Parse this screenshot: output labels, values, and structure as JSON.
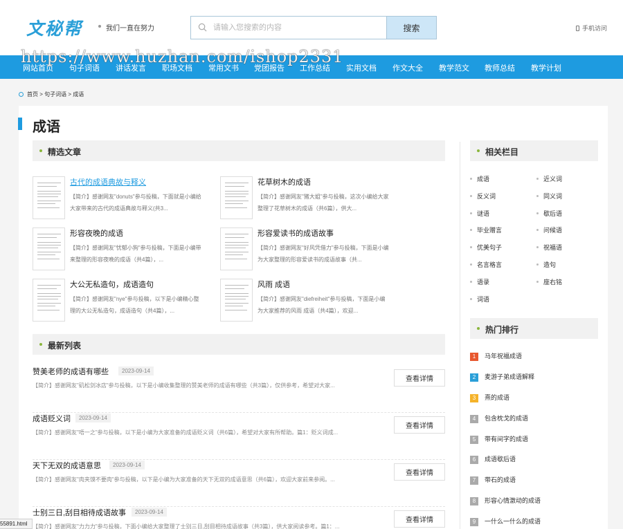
{
  "header": {
    "logo_text": "文秘帮",
    "slogan": "我们一直在努力",
    "search_placeholder": "请输入您搜索的内容",
    "search_button": "搜索",
    "mobile_link": "手机访问"
  },
  "nav": {
    "items": [
      "网站首页",
      "句子词语",
      "讲话发言",
      "职场文档",
      "常用文书",
      "党团报告",
      "工作总结",
      "实用文档",
      "作文大全",
      "教学范文",
      "教师总结",
      "教学计划"
    ],
    "watermark": "https://www.huzhan.com/ishop2331"
  },
  "breadcrumb": {
    "home": "首页",
    "sep": ">",
    "level1": "句子词语",
    "current": "成语"
  },
  "page_title": "成语",
  "featured": {
    "heading": "精选文章",
    "items": [
      {
        "title": "古代的成语典故与释义",
        "desc": "【简介】感谢网友\"donuts\"参与投稿，下面就是小编给大家带来的古代的成语典故与释义(共3..."
      },
      {
        "title": "花草树木的成语",
        "desc": "【简介】感谢网友\"猪大姐\"参与投稿，这次小编给大家整理了花草树木的成语（共6篇），供大..."
      },
      {
        "title": "形容夜晚的成语",
        "desc": "【简介】感谢网友\"忧郁小狗\"参与投稿，下面是小编带来整理的形容夜晚的成语（共4篇），..."
      },
      {
        "title": "形容爱读书的成语故事",
        "desc": "【简介】感谢网友\"好风凭借力\"参与投稿，下面是小编为大家整理的形容爱读书的成语故事（共..."
      },
      {
        "title": "大公无私造句，成语造句",
        "desc": "【简介】感谢网友\"nye\"参与投稿，以下是小编精心整理的大公无私造句，成语造句（共4篇），..."
      },
      {
        "title": "风雨 成语",
        "desc": "【简介】感谢网友\"diefreiheit\"参与投稿，下面是小编为大家推荐的风雨 成语（共4篇），欢迎..."
      }
    ]
  },
  "latest": {
    "heading": "最新列表",
    "button": "查看详情",
    "items": [
      {
        "title": "赞美老师的成语有哪些",
        "date": "2023-09-14",
        "summary": "【简介】感谢网友\"矶松剑冰店\"参与投稿，以下是小编收集整理的赞美老师的成语有哪些（共3篇），仅供参考，希望对大家..."
      },
      {
        "title": "成语贬义词",
        "date": "2023-09-14",
        "summary": "【简介】感谢网友\"唔一之\"参与投稿，以下是小编为大家准备的成语贬义词（共6篇），希望对大家有所帮助。篇1：贬义词成..."
      },
      {
        "title": "天下无双的成语意思",
        "date": "2023-09-14",
        "summary": "【简介】感谢网友\"肉夹馍不要肉\"参与投稿，以下是小编为大家准备的天下无双的成语意思（共6篇），欢迎大家前来参阅。..."
      },
      {
        "title": "士别三日,刮目相待成语故事",
        "date": "2023-09-14",
        "summary": "【简介】感谢网友\"力力力\"参与投稿，下面小编给大家整理了士别三日,刮目相待成语故事（共3篇），供大家阅读参考。篇1：..."
      }
    ]
  },
  "related": {
    "heading": "相关栏目",
    "items": [
      "成语",
      "近义词",
      "反义词",
      "同义词",
      "谜语",
      "歇后语",
      "毕业赠言",
      "问候语",
      "优美句子",
      "祝福语",
      "名言格言",
      "造句",
      "语录",
      "座右铭",
      "词语"
    ]
  },
  "hot": {
    "heading": "热门排行",
    "items": [
      {
        "rank": "1",
        "title": "马年祝福成语",
        "color": "#e8572e"
      },
      {
        "rank": "2",
        "title": "麦游子弟成语解释",
        "color": "#2a9fd8"
      },
      {
        "rank": "3",
        "title": "熹的成语",
        "color": "#f5b32a"
      },
      {
        "rank": "4",
        "title": "包含枕戈的成语",
        "color": "#aaaaaa"
      },
      {
        "rank": "5",
        "title": "带有间字的成语",
        "color": "#aaaaaa"
      },
      {
        "rank": "6",
        "title": "成语歇后语",
        "color": "#aaaaaa"
      },
      {
        "rank": "7",
        "title": "带石的成语",
        "color": "#aaaaaa"
      },
      {
        "rank": "8",
        "title": "形容心情激动的成语",
        "color": "#aaaaaa"
      },
      {
        "rank": "9",
        "title": "一什么一什么的成语",
        "color": "#aaaaaa"
      }
    ]
  },
  "statusbar": "55891.html",
  "colors": {
    "accent": "#1e9be0",
    "dot": "#8ab63c"
  }
}
